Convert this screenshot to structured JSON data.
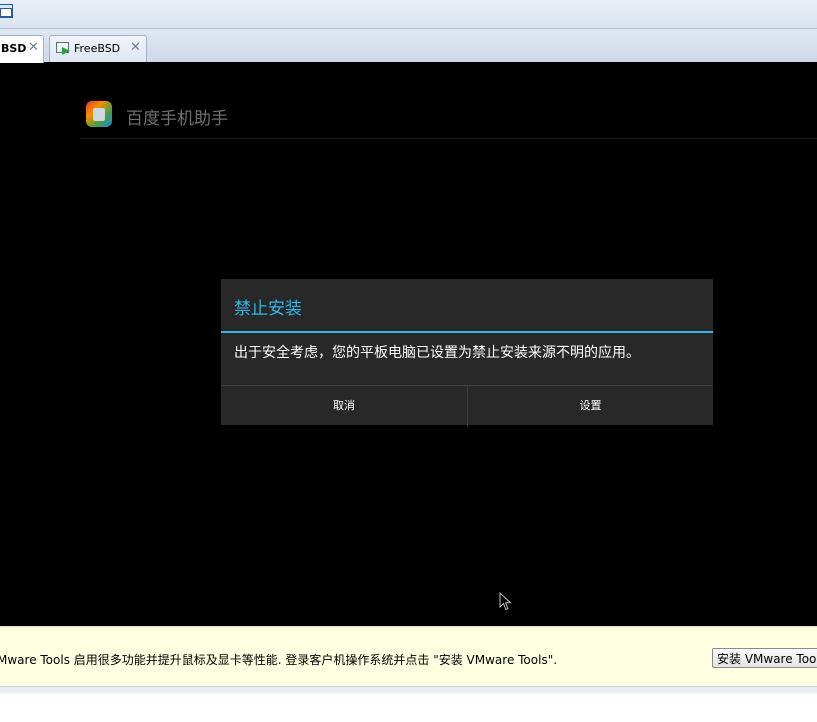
{
  "toolbar": {
    "icon": "window-icon"
  },
  "tabs": [
    {
      "label": "BSD",
      "close": "✕",
      "active": true
    },
    {
      "label": "FreeBSD",
      "close": "✕",
      "active": false,
      "icon": "vm-play-icon"
    }
  ],
  "app": {
    "title": "百度手机助手",
    "logo": "baidu-app-logo"
  },
  "dialog": {
    "title": "禁止安装",
    "message": "出于安全考虑，您的平板电脑已设置为禁止安装来源不明的应用。",
    "cancel_label": "取消",
    "settings_label": "设置",
    "accent_color": "#33b5e5"
  },
  "notice": {
    "text": "Mware Tools 启用很多功能并提升鼠标及显卡等性能. 登录客户机操作系统并点击 \"安装 VMware Tools\".",
    "button_label": "安装 VMware Tools"
  }
}
